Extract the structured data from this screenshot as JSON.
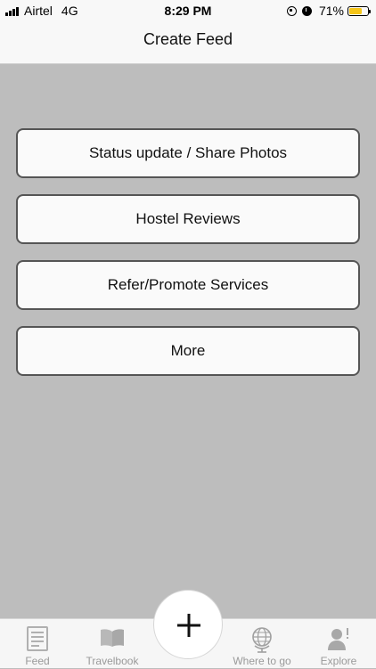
{
  "status_bar": {
    "carrier": "Airtel",
    "network": "4G",
    "time": "8:29 PM",
    "battery_percent": "71%",
    "battery_level": 0.71,
    "battery_color": "#f5c518"
  },
  "nav": {
    "title": "Create Feed"
  },
  "options": [
    {
      "label": "Status update / Share Photos"
    },
    {
      "label": "Hostel Reviews"
    },
    {
      "label": "Refer/Promote Services"
    },
    {
      "label": "More"
    }
  ],
  "tabs": [
    {
      "label": "Feed",
      "icon": "feed-icon"
    },
    {
      "label": "Travelbook",
      "icon": "book-icon"
    },
    {
      "label": "Where to go",
      "icon": "globe-icon"
    },
    {
      "label": "Explore",
      "icon": "profile-icon"
    }
  ],
  "center_action": {
    "icon": "plus-icon"
  },
  "colors": {
    "background": "#bdbdbd",
    "tab_inactive": "#9a9a9a"
  }
}
